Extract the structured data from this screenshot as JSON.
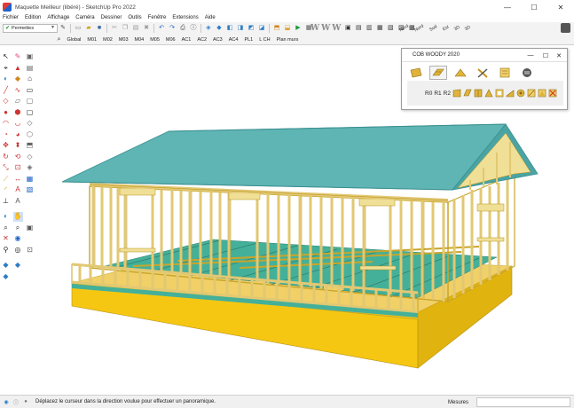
{
  "window": {
    "title": "Maquette Meilleur (libéré) - SketchUp Pro 2022",
    "controls": [
      "minimize",
      "maximize",
      "close"
    ]
  },
  "menu": [
    "Fichier",
    "Edition",
    "Affichage",
    "Caméra",
    "Dessiner",
    "Outils",
    "Fenêtre",
    "Extensions",
    "Aide"
  ],
  "layers": {
    "selected": "Permettes"
  },
  "scenes": [
    "Global",
    "M01",
    "M02",
    "M03",
    "M04",
    "M05",
    "M06",
    "AC1",
    "AC2",
    "AC3",
    "AC4",
    "PL1",
    "L CH",
    "Plan murs"
  ],
  "toolbar_rotated_labels": [
    "Nord",
    "Nord",
    "Sud",
    "Est",
    "3D",
    "3D"
  ],
  "cob_panel": {
    "title": "COB WOODY 2020",
    "labels": [
      "R0",
      "R1",
      "R2"
    ]
  },
  "status": {
    "message": "Déplacez le curseur dans la direction voulue pour effectuer un panoramique.",
    "measures_label": "Mesures"
  },
  "colors": {
    "roof": "#5fb4b4",
    "timber": "#f0df96",
    "floor_panels": "#44b09a",
    "foundation": "#f6c712",
    "accent": "#1e63c7"
  }
}
